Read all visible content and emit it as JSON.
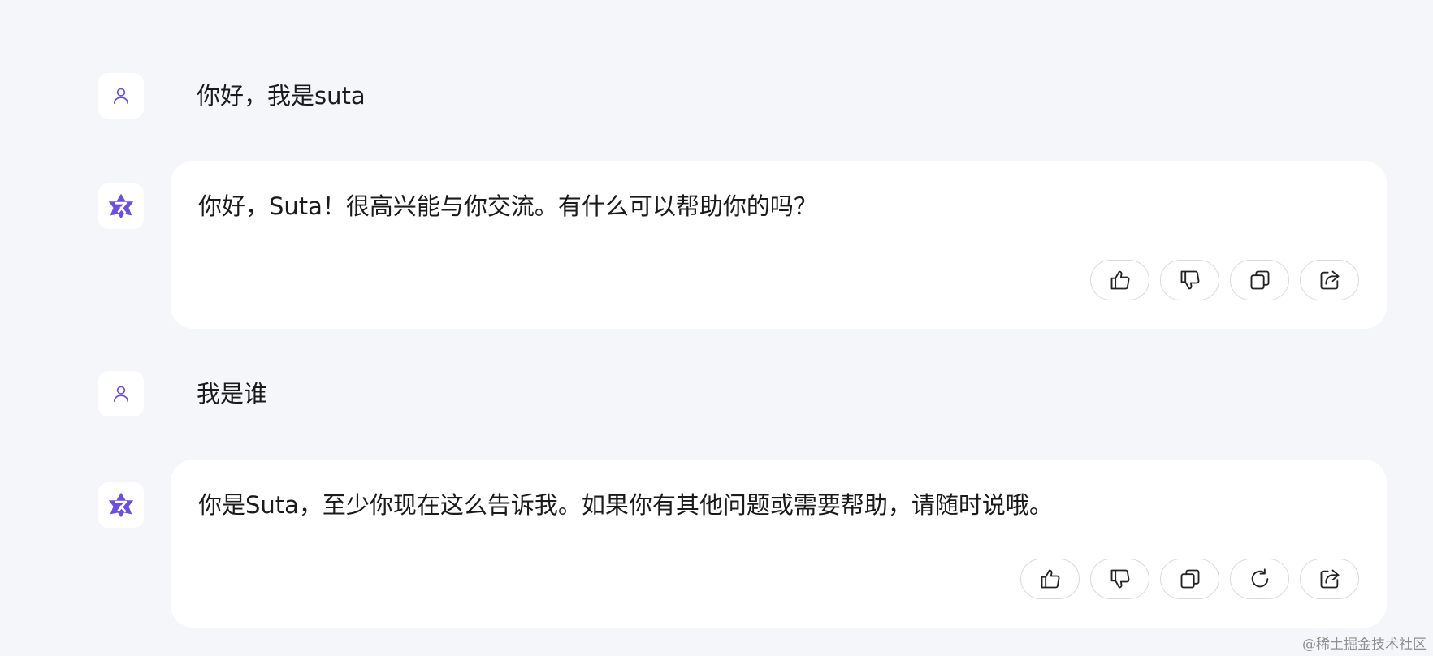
{
  "messages": [
    {
      "role": "user",
      "text": "你好，我是suta",
      "avatar_icon": "person-icon"
    },
    {
      "role": "assistant",
      "text": "你好，Suta！很高兴能与你交流。有什么可以帮助你的吗？",
      "avatar_icon": "assistant-logo-icon",
      "actions": [
        "thumbs-up-icon",
        "thumbs-down-icon",
        "copy-icon",
        "share-icon"
      ]
    },
    {
      "role": "user",
      "text": "我是谁",
      "avatar_icon": "person-icon"
    },
    {
      "role": "assistant",
      "text": "你是Suta，至少你现在这么告诉我。如果你有其他问题或需要帮助，请随时说哦。",
      "avatar_icon": "assistant-logo-icon",
      "actions": [
        "thumbs-up-icon",
        "thumbs-down-icon",
        "copy-icon",
        "regenerate-icon",
        "share-icon"
      ]
    }
  ],
  "watermark": "@稀土掘金技术社区",
  "colors": {
    "background": "#f5f6fa",
    "bubble": "#ffffff",
    "accent": "#6b4fe0",
    "button_border": "#d9d9de"
  }
}
